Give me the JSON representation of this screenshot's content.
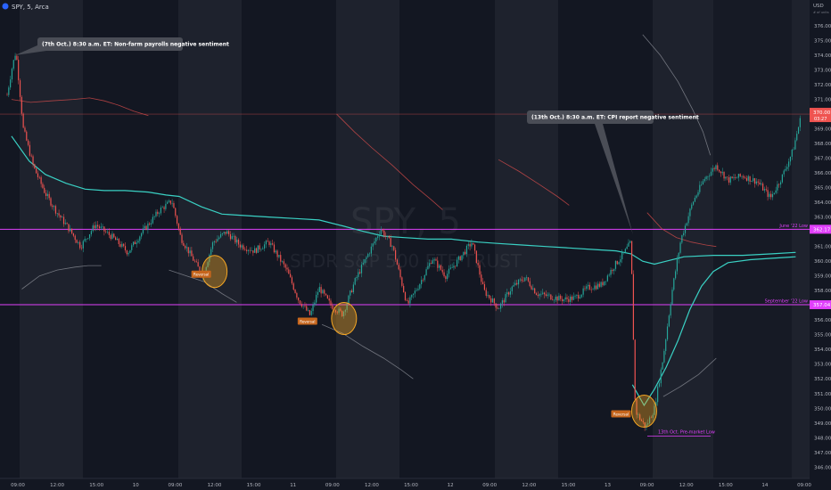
{
  "header": {
    "symbol": "SPY",
    "interval": "5",
    "exchange": "Arca",
    "title": "SPY, 5, Arca"
  },
  "price_axis": {
    "currency": "USD",
    "note": "# of units"
  },
  "watermark": {
    "line1": "SPY, 5",
    "line2": "SPDR S&P 500 ETF TRUST"
  },
  "annotations": [
    {
      "text": "(7th Oct.) 8:30 a.m. ET: Non-farm payrolls negative sentiment"
    },
    {
      "text": "(13th Oct.) 8:30 a.m. ET: CPI report negative sentiment"
    }
  ],
  "levels": [
    {
      "label": "June '22 Low",
      "price": 362.17,
      "price_label": "362.17"
    },
    {
      "label": "September '22 Low",
      "price": 357.04,
      "price_label": "357.04"
    },
    {
      "label": "13th Oct. Pre-market Low",
      "price": 348.11
    }
  ],
  "last_price": {
    "price": 370.0,
    "label": "370.00",
    "countdown": "03:27"
  },
  "reversal_labels": [
    "Reversal",
    "Reversal",
    "Reversal"
  ],
  "colors": {
    "up": "#26a69a",
    "down": "#ef5350",
    "level": "#e040fb",
    "vwap": "#3ad1c4",
    "band_upper": "#ef5350",
    "band_lower": "#9598a1",
    "highlight": "#f5a623"
  },
  "chart_data": {
    "type": "candlestick",
    "y_axis": {
      "ylim": [
        345.5,
        377.5
      ],
      "ticks": [
        346,
        347,
        348,
        349,
        350,
        351,
        352,
        353,
        354,
        355,
        356,
        357,
        358,
        359,
        360,
        361,
        362,
        363,
        364,
        365,
        366,
        367,
        368,
        369,
        370,
        371,
        372,
        373,
        374,
        375,
        376
      ]
    },
    "x_axis": {
      "ticks": [
        "09:00",
        "12:00",
        "15:00",
        "10",
        "09:00",
        "12:00",
        "15:00",
        "11",
        "09:00",
        "12:00",
        "15:00",
        "12",
        "09:00",
        "12:00",
        "15:00",
        "13",
        "09:00",
        "12:00",
        "15:00",
        "14",
        "09:00"
      ]
    },
    "price_path": [
      [
        0,
        371.3
      ],
      [
        0.3,
        373.0
      ],
      [
        0.6,
        374.3
      ],
      [
        1.1,
        369.0
      ],
      [
        1.8,
        366.4
      ],
      [
        2.6,
        364.6
      ],
      [
        3.4,
        363.3
      ],
      [
        4.2,
        362.2
      ],
      [
        5.0,
        361.0
      ],
      [
        6.0,
        362.5
      ],
      [
        7.2,
        361.6
      ],
      [
        8.2,
        360.6
      ],
      [
        9.2,
        362.0
      ],
      [
        10.4,
        363.5
      ],
      [
        11.2,
        364.1
      ],
      [
        11.8,
        361.6
      ],
      [
        12.6,
        360.2
      ],
      [
        13.3,
        359.0
      ],
      [
        14.0,
        361.3
      ],
      [
        14.9,
        362.0
      ],
      [
        15.8,
        361.1
      ],
      [
        16.8,
        360.7
      ],
      [
        17.8,
        361.3
      ],
      [
        19.0,
        359.4
      ],
      [
        19.8,
        357.4
      ],
      [
        20.6,
        356.3
      ],
      [
        21.2,
        358.2
      ],
      [
        22.0,
        357.0
      ],
      [
        22.8,
        356.4
      ],
      [
        23.7,
        358.8
      ],
      [
        24.6,
        360.6
      ],
      [
        25.4,
        362.2
      ],
      [
        26.2,
        361.0
      ],
      [
        27.2,
        357.0
      ],
      [
        28.0,
        358.4
      ],
      [
        28.9,
        360.2
      ],
      [
        29.8,
        359.0
      ],
      [
        30.6,
        360.0
      ],
      [
        31.6,
        361.3
      ],
      [
        32.4,
        358.0
      ],
      [
        33.4,
        356.8
      ],
      [
        34.3,
        358.2
      ],
      [
        35.2,
        358.9
      ],
      [
        36.0,
        357.8
      ],
      [
        36.9,
        357.6
      ],
      [
        37.8,
        357.4
      ],
      [
        38.6,
        357.5
      ],
      [
        39.5,
        358.2
      ],
      [
        40.4,
        358.4
      ],
      [
        41.2,
        359.6
      ],
      [
        41.9,
        360.5
      ],
      [
        42.4,
        361.3
      ],
      [
        42.7,
        349.8
      ],
      [
        43.4,
        348.7
      ],
      [
        44.0,
        350.0
      ],
      [
        44.6,
        353.5
      ],
      [
        45.2,
        358.0
      ],
      [
        45.8,
        361.5
      ],
      [
        46.6,
        364.0
      ],
      [
        47.4,
        365.6
      ],
      [
        48.2,
        366.5
      ],
      [
        49.0,
        365.5
      ],
      [
        50.0,
        365.8
      ],
      [
        51.0,
        365.4
      ],
      [
        51.9,
        364.3
      ],
      [
        52.7,
        365.8
      ],
      [
        53.4,
        367.5
      ],
      [
        54.0,
        370.0
      ]
    ],
    "series": [
      {
        "name": "",
        "path": [
          [
            0.3,
            368.5
          ],
          [
            1.5,
            366.8
          ],
          [
            2.6,
            365.9
          ],
          [
            4.0,
            365.3
          ],
          [
            5.3,
            364.9
          ],
          [
            6.6,
            364.8
          ],
          [
            8.0,
            364.8
          ],
          [
            9.6,
            364.7
          ],
          [
            10.8,
            364.5
          ],
          [
            11.7,
            364.4
          ],
          [
            13.2,
            363.7
          ],
          [
            14.6,
            363.2
          ],
          [
            16.2,
            363.1
          ],
          [
            17.8,
            363.0
          ],
          [
            19.6,
            362.9
          ],
          [
            21.2,
            362.8
          ],
          [
            22.8,
            362.4
          ],
          [
            24.3,
            362.0
          ],
          [
            25.6,
            361.7
          ],
          [
            27.0,
            361.6
          ],
          [
            28.6,
            361.5
          ],
          [
            30.2,
            361.5
          ],
          [
            32.0,
            361.3
          ],
          [
            33.4,
            361.2
          ],
          [
            35.0,
            361.1
          ],
          [
            36.6,
            361.0
          ],
          [
            38.2,
            360.9
          ],
          [
            39.8,
            360.8
          ],
          [
            41.4,
            360.7
          ],
          [
            42.4,
            360.5
          ],
          [
            43.2,
            360.0
          ],
          [
            44.0,
            359.8
          ],
          [
            44.8,
            360.0
          ],
          [
            46.0,
            360.3
          ],
          [
            48.0,
            360.4
          ],
          [
            50.0,
            360.4
          ],
          [
            52.0,
            360.5
          ],
          [
            53.6,
            360.6
          ]
        ]
      },
      {
        "name": "",
        "path": [
          [
            42.5,
            351.6
          ],
          [
            43.3,
            350.2
          ],
          [
            44.0,
            351.3
          ],
          [
            44.8,
            352.8
          ],
          [
            45.6,
            354.6
          ],
          [
            46.4,
            356.7
          ],
          [
            47.2,
            358.3
          ],
          [
            48.0,
            359.3
          ],
          [
            49.0,
            359.9
          ],
          [
            50.5,
            360.1
          ],
          [
            52.0,
            360.2
          ],
          [
            53.6,
            360.3
          ]
        ]
      },
      {
        "name": "",
        "path": [
          [
            0.3,
            371.0
          ],
          [
            1.6,
            370.8
          ],
          [
            3.0,
            370.9
          ],
          [
            4.5,
            371.0
          ],
          [
            5.6,
            371.1
          ],
          [
            6.6,
            370.9
          ],
          [
            7.6,
            370.6
          ],
          [
            8.6,
            370.2
          ],
          [
            9.6,
            369.9
          ]
        ]
      },
      {
        "name": "",
        "path": [
          [
            22.4,
            370.0
          ],
          [
            23.6,
            368.8
          ],
          [
            24.8,
            367.7
          ],
          [
            26.2,
            366.5
          ],
          [
            27.6,
            365.2
          ],
          [
            28.8,
            364.2
          ],
          [
            29.6,
            363.5
          ]
        ]
      },
      {
        "name": "",
        "path": [
          [
            33.4,
            366.9
          ],
          [
            34.8,
            366.1
          ],
          [
            36.2,
            365.2
          ],
          [
            37.4,
            364.4
          ],
          [
            38.2,
            363.8
          ]
        ]
      },
      {
        "name": "",
        "path": [
          [
            43.5,
            363.3
          ],
          [
            44.5,
            362.2
          ],
          [
            45.5,
            361.6
          ],
          [
            46.5,
            361.3
          ],
          [
            47.5,
            361.1
          ],
          [
            48.2,
            361.0
          ]
        ]
      },
      {
        "name": "",
        "path": [
          [
            1.0,
            358.1
          ],
          [
            2.2,
            359.0
          ],
          [
            3.4,
            359.4
          ],
          [
            4.6,
            359.6
          ],
          [
            5.5,
            359.7
          ],
          [
            6.4,
            359.7
          ]
        ]
      },
      {
        "name": "",
        "path": [
          [
            11.0,
            359.4
          ],
          [
            12.2,
            359.0
          ],
          [
            13.4,
            358.6
          ],
          [
            14.6,
            357.8
          ],
          [
            15.6,
            357.2
          ]
        ]
      },
      {
        "name": "",
        "path": [
          [
            21.4,
            355.7
          ],
          [
            22.8,
            355.1
          ],
          [
            24.2,
            354.2
          ],
          [
            25.6,
            353.4
          ],
          [
            26.8,
            352.6
          ],
          [
            27.6,
            352.0
          ]
        ]
      },
      {
        "name": "",
        "path": [
          [
            43.2,
            375.4
          ],
          [
            44.4,
            374.0
          ],
          [
            45.6,
            372.2
          ],
          [
            46.6,
            370.3
          ],
          [
            47.3,
            368.8
          ],
          [
            47.8,
            367.2
          ]
        ]
      },
      {
        "name": "",
        "path": [
          [
            44.6,
            350.8
          ],
          [
            45.8,
            351.5
          ],
          [
            47.0,
            352.3
          ],
          [
            48.2,
            353.4
          ]
        ]
      }
    ]
  }
}
